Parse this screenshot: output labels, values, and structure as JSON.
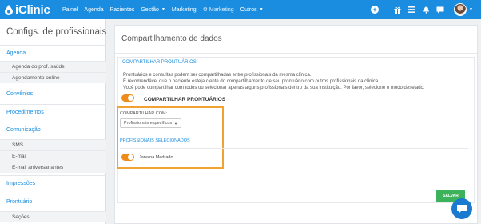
{
  "app": {
    "brand": "iClinic"
  },
  "nav": [
    {
      "label": "Painel"
    },
    {
      "label": "Agenda"
    },
    {
      "label": "Pacientes"
    },
    {
      "label": "Gestão",
      "caret": "▼"
    },
    {
      "label": "Marketing"
    },
    {
      "label": "Marketing",
      "icon": "⚙"
    },
    {
      "label": "Outros",
      "caret": "▼"
    }
  ],
  "topbar_icons": [
    "plus-circle-icon",
    "gift-icon",
    "menu-icon",
    "bell-icon",
    "chat-icon",
    "avatar"
  ],
  "sidebar": {
    "title": "Configs. de profissionais",
    "items": [
      {
        "type": "section",
        "label": "Agenda"
      },
      {
        "type": "sub",
        "label": "Agenda do prof. saúde"
      },
      {
        "type": "sub",
        "label": "Agendamento online"
      },
      {
        "type": "section",
        "label": "Convênios"
      },
      {
        "type": "section",
        "label": "Procedimentos"
      },
      {
        "type": "section",
        "label": "Comunicação"
      },
      {
        "type": "sub",
        "label": "SMS"
      },
      {
        "type": "sub",
        "label": "E-mail"
      },
      {
        "type": "sub",
        "label": "E-mail aniversariantes"
      },
      {
        "type": "section",
        "label": "Impressões"
      },
      {
        "type": "section",
        "label": "Prontuário"
      },
      {
        "type": "sub",
        "label": "Seções"
      }
    ]
  },
  "main": {
    "title": "Compartilhamento de dados",
    "section_label": "COMPARTILHAR PRONTUÁRIOS",
    "description": [
      "Prontuários e consultas podem ser compartilhadas entre profissionais da mesma clínica.",
      "É recomendável que o paciente esteja ciente do compartilhamento de seu prontuário com outros profissionais da clínica.",
      "Você pode compartilhar com todos ou selecionar apenas alguns profissionais dentro da sua instituição. Por favor, selecione o modo desejado:"
    ],
    "toggle_label": "COMPARTILHAR PRONTUÁRIOS",
    "toggle_on": true,
    "share_with_label": "COMPARTILHAR COM:",
    "share_with_value": "Profissionais específicos",
    "selected_label": "PROFISSIONAIS SELECIONADOS",
    "professionals": [
      {
        "name": "Janaina Medrado",
        "enabled": true
      }
    ],
    "save_label": "SALVAR"
  },
  "colors": {
    "navbar": "#1a8de0",
    "accent": "#1a8de0",
    "toggle": "#f08a19",
    "highlight": "#f0a233",
    "save": "#3cb35a"
  }
}
